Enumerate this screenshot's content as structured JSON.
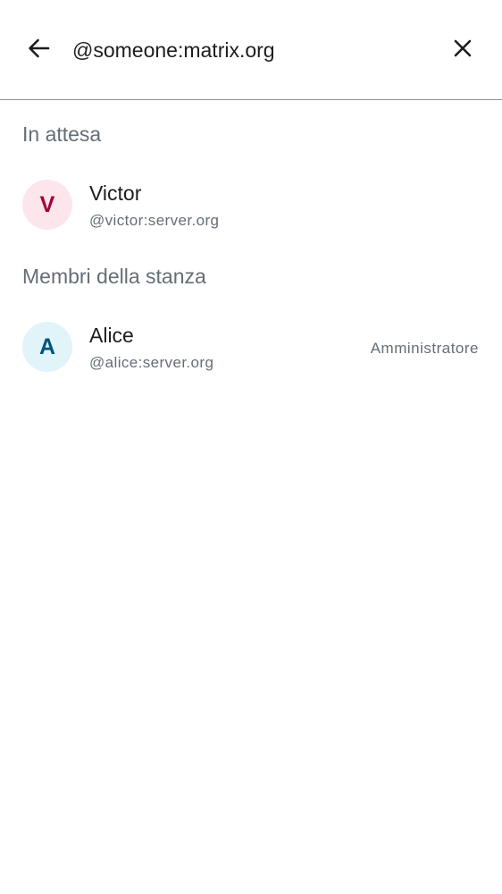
{
  "search": {
    "value": "@someone:matrix.org"
  },
  "icons": {
    "back": "arrow-back-icon",
    "clear": "close-icon"
  },
  "sections": {
    "pending": {
      "title": "In attesa",
      "members": [
        {
          "initial": "V",
          "name": "Victor",
          "user_id": "@victor:server.org",
          "role": "",
          "avatar_bg": "#fde5ec",
          "avatar_fg": "#a3003a"
        }
      ]
    },
    "room_members": {
      "title": "Membri della stanza",
      "members": [
        {
          "initial": "A",
          "name": "Alice",
          "user_id": "@alice:server.org",
          "role": "Amministratore",
          "avatar_bg": "#e0f4fa",
          "avatar_fg": "#005478"
        }
      ]
    }
  }
}
